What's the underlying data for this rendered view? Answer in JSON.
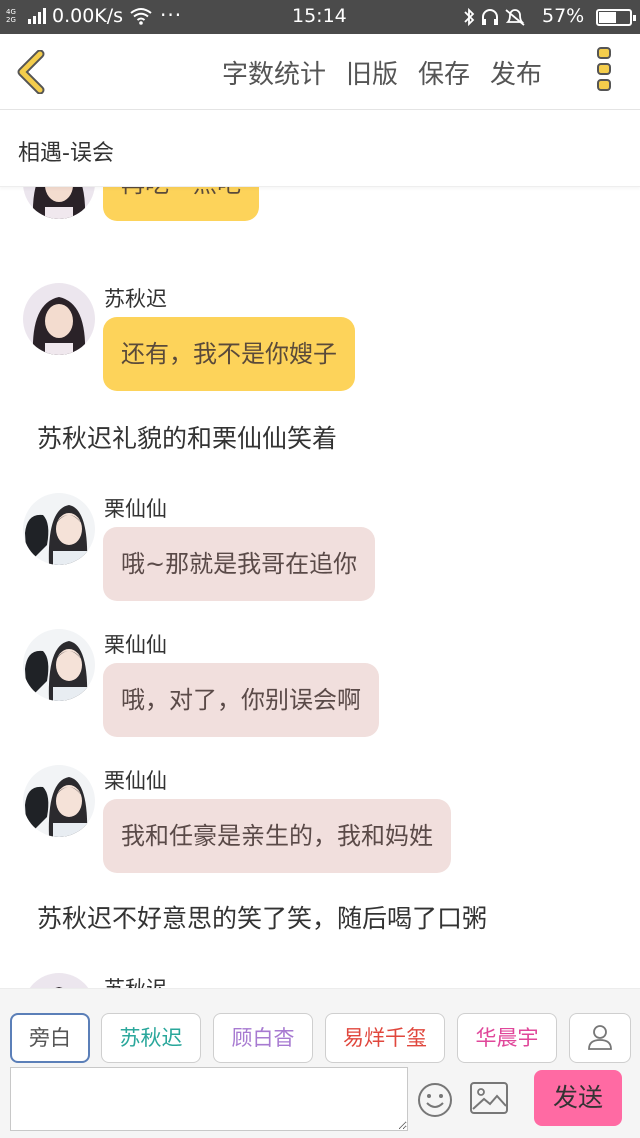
{
  "status_bar": {
    "network_4g": "4G",
    "network_2g": "2G",
    "speed": "0.00K/s",
    "more": "···",
    "time": "15:14",
    "battery_percent": "57%",
    "battery_level": 0.57
  },
  "toolbar": {
    "word_count_label": "字数统计",
    "old_version_label": "旧版",
    "save_label": "保存",
    "publish_label": "发布"
  },
  "chapter": {
    "title": "相遇-误会"
  },
  "messages": [
    {
      "type": "bubble",
      "avatar": "su",
      "color": "yellow",
      "text": "再吃一点吧"
    },
    {
      "type": "bubble",
      "avatar": "su",
      "color": "yellow",
      "sender": "苏秋迟",
      "text": "还有，我不是你嫂子"
    },
    {
      "type": "narration",
      "text": "苏秋迟礼貌的和栗仙仙笑着"
    },
    {
      "type": "bubble",
      "avatar": "li",
      "color": "pink",
      "sender": "栗仙仙",
      "text": "哦~那就是我哥在追你"
    },
    {
      "type": "bubble",
      "avatar": "li",
      "color": "pink",
      "sender": "栗仙仙",
      "text": "哦，对了，你别误会啊"
    },
    {
      "type": "bubble",
      "avatar": "li",
      "color": "pink",
      "sender": "栗仙仙",
      "text": "我和任豪是亲生的，我和妈姓"
    },
    {
      "type": "narration",
      "text": "苏秋迟不好意思的笑了笑，随后喝了口粥"
    },
    {
      "type": "bubble",
      "avatar": "su",
      "color": "yellow",
      "sender": "苏秋迟",
      "text": ""
    }
  ],
  "characters": [
    {
      "name": "旁白",
      "color": "#555555"
    },
    {
      "name": "苏秋迟",
      "color": "#2aa79b"
    },
    {
      "name": "顾白杳",
      "color": "#a77ad1"
    },
    {
      "name": "易烊千玺",
      "color": "#e0473d"
    },
    {
      "name": "华晨宇",
      "color": "#e0479a"
    }
  ],
  "input": {
    "placeholder": "",
    "send_label": "发送"
  },
  "colors": {
    "accent_yellow": "#fdd35a",
    "bubble_pink": "#f1dfdd",
    "send_pink": "#ff6aa3",
    "status_bar": "#4b4b4b"
  },
  "icons": {
    "back": "chevron-left-icon",
    "more": "more-vertical-icon",
    "user": "user-icon",
    "emoji": "smiley-icon",
    "image": "image-icon"
  }
}
